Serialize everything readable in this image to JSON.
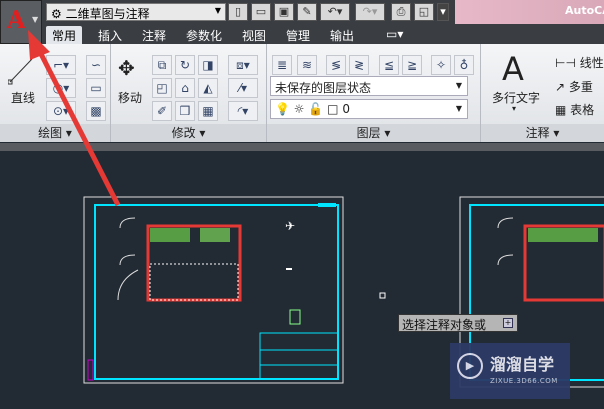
{
  "app": {
    "title": "AutoCAD",
    "logo": "A"
  },
  "quick_access": {
    "workspace": "二维草图与注释",
    "icons": [
      "new-icon",
      "open-icon",
      "save-icon",
      "saveas-icon",
      "undo-icon",
      "redo-icon",
      "print-icon",
      "preview-icon"
    ]
  },
  "tabs": [
    "常用",
    "插入",
    "注释",
    "参数化",
    "视图",
    "管理",
    "输出"
  ],
  "ribbon": {
    "draw": {
      "label": "绘图",
      "line_label": "直线"
    },
    "modify": {
      "label": "修改",
      "move_label": "移动"
    },
    "layers": {
      "label": "图层",
      "state": "未保存的图层状态",
      "current_layer": "0"
    },
    "annotation": {
      "label": "注释",
      "mtext_label": "多行文字",
      "items": [
        "线性",
        "多重",
        "表格"
      ],
      "big_a": "A"
    }
  },
  "canvas": {
    "tooltip": "选择注释对象或"
  },
  "watermark": {
    "title": "溜溜自学",
    "url": "ZIXUE.3D66.COM"
  },
  "colors": {
    "arrow": "#e53935",
    "frame": "#00e5ff",
    "canvas": "#222a33"
  }
}
